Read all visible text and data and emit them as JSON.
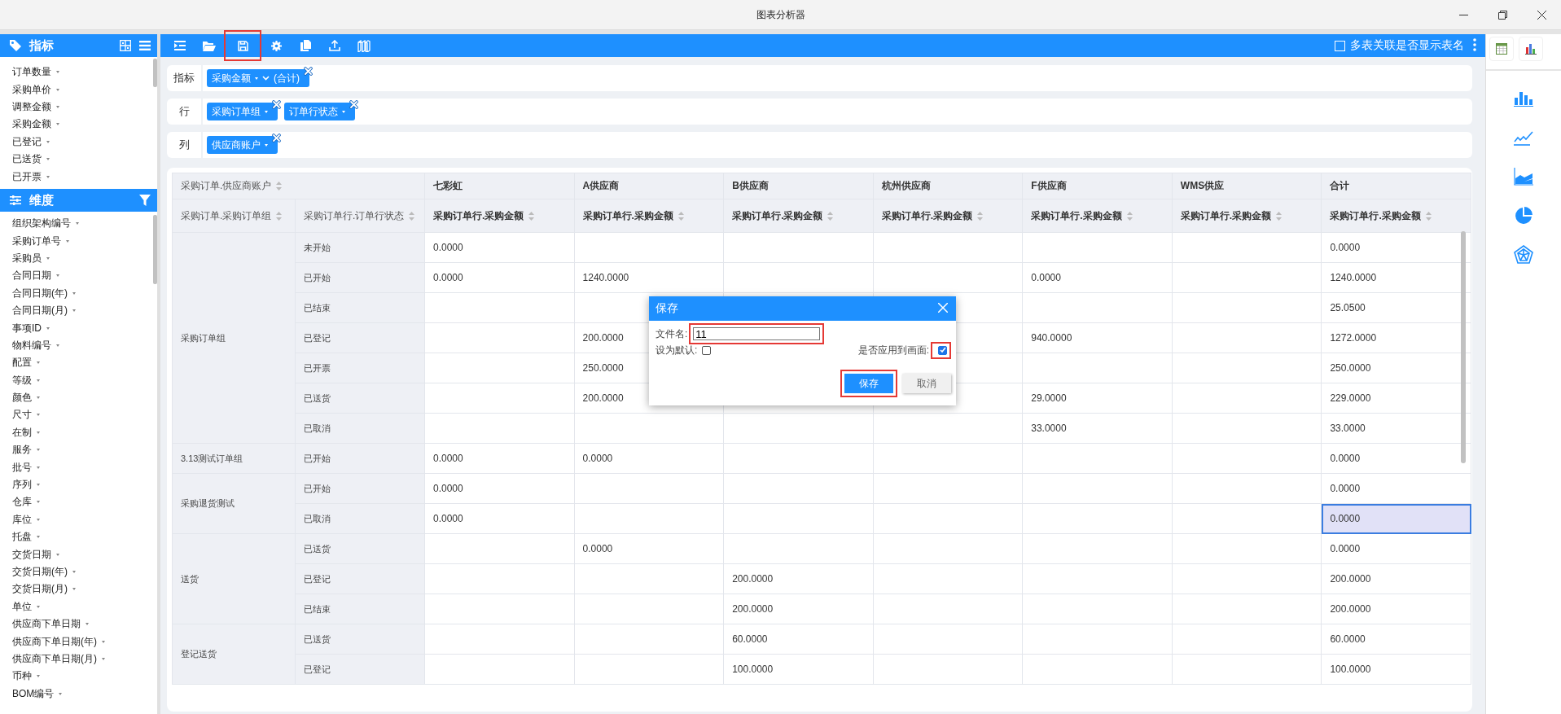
{
  "window": {
    "title": "图表分析器"
  },
  "sidebar": {
    "measures": {
      "title": "指标",
      "items": [
        "订单数量",
        "采购单价",
        "调整金额",
        "采购金额",
        "已登记",
        "已送货",
        "已开票"
      ]
    },
    "dimensions": {
      "title": "维度",
      "items": [
        "组织架构编号",
        "采购订单号",
        "采购员",
        "合同日期",
        "合同日期(年)",
        "合同日期(月)",
        "事项ID",
        "物料编号",
        "配置",
        "等级",
        "颜色",
        "尺寸",
        "在制",
        "服务",
        "批号",
        "序列",
        "仓库",
        "库位",
        "托盘",
        "交货日期",
        "交货日期(年)",
        "交货日期(月)",
        "单位",
        "供应商下单日期",
        "供应商下单日期(年)",
        "供应商下单日期(月)",
        "币种",
        "BOM编号"
      ]
    }
  },
  "toolbar": {
    "buttons": [
      {
        "kind": "indent",
        "highlighted": false
      },
      {
        "kind": "folder",
        "highlighted": false
      },
      {
        "kind": "save",
        "highlighted": true
      },
      {
        "kind": "settings",
        "highlighted": false
      },
      {
        "kind": "copy",
        "highlighted": false
      },
      {
        "kind": "upload",
        "highlighted": false
      },
      {
        "kind": "books",
        "highlighted": false
      }
    ],
    "show_table_names": {
      "label": "多表关联是否显示表名",
      "checked": false
    }
  },
  "shelves": [
    {
      "label": "指标",
      "chips": [
        {
          "text": "采购金额",
          "aggregate": "(合计)"
        }
      ]
    },
    {
      "label": "行",
      "chips": [
        {
          "text": "采购订单组"
        },
        {
          "text": "订单行状态"
        }
      ]
    },
    {
      "label": "列",
      "chips": [
        {
          "text": "供应商账户"
        }
      ]
    }
  ],
  "table": {
    "corner_label": "采购订单.供应商账户",
    "suppliers": [
      "七彩虹",
      "A供应商",
      "B供应商",
      "杭州供应商",
      "F供应商",
      "WMS供应",
      "合计"
    ],
    "row_headers": [
      "采购订单.采购订单组",
      "采购订单行.订单行状态"
    ],
    "measure_headers": [
      "采购订单行.采购金额",
      "采购订单行.采购金额",
      "采购订单行.采购金额",
      "采购订单行.采购金额",
      "采购订单行.采购金额",
      "采购订单行.采购金额",
      "采购订单行.采购金额"
    ],
    "groups": [
      {
        "name": "采购订单组",
        "rows": [
          {
            "status": "未开始",
            "selected": false,
            "cells": [
              "0.0000",
              null,
              null,
              null,
              null,
              null,
              "0.0000"
            ]
          },
          {
            "status": "已开始",
            "selected": false,
            "cells": [
              "0.0000",
              "1240.0000",
              null,
              null,
              "0.0000",
              null,
              "1240.0000"
            ]
          },
          {
            "status": "已结束",
            "selected": false,
            "cells": [
              null,
              null,
              null,
              null,
              null,
              null,
              "25.0500"
            ]
          },
          {
            "status": "已登记",
            "selected": false,
            "cells": [
              null,
              "200.0000",
              null,
              null,
              "940.0000",
              null,
              "1272.0000"
            ]
          },
          {
            "status": "已开票",
            "selected": false,
            "cells": [
              null,
              "250.0000",
              null,
              null,
              null,
              null,
              "250.0000"
            ]
          },
          {
            "status": "已送货",
            "selected": false,
            "cells": [
              null,
              "200.0000",
              null,
              null,
              "29.0000",
              null,
              "229.0000"
            ]
          },
          {
            "status": "已取消",
            "selected": false,
            "cells": [
              null,
              null,
              null,
              null,
              "33.0000",
              null,
              "33.0000"
            ]
          }
        ]
      },
      {
        "name": "3.13测试订单组",
        "rows": [
          {
            "status": "已开始",
            "selected": false,
            "cells": [
              "0.0000",
              "0.0000",
              null,
              null,
              null,
              null,
              "0.0000"
            ]
          }
        ]
      },
      {
        "name": "采购退货测试",
        "rows": [
          {
            "status": "已开始",
            "selected": false,
            "cells": [
              "0.0000",
              null,
              null,
              null,
              null,
              null,
              "0.0000"
            ]
          },
          {
            "status": "已取消",
            "selected": true,
            "cells": [
              "0.0000",
              null,
              null,
              null,
              null,
              null,
              "0.0000"
            ]
          }
        ]
      },
      {
        "name": "送货",
        "rows": [
          {
            "status": "已送货",
            "selected": false,
            "cells": [
              null,
              "0.0000",
              null,
              null,
              null,
              null,
              "0.0000"
            ]
          },
          {
            "status": "已登记",
            "selected": false,
            "cells": [
              null,
              null,
              "200.0000",
              null,
              null,
              null,
              "200.0000"
            ]
          },
          {
            "status": "已结束",
            "selected": false,
            "cells": [
              null,
              null,
              "200.0000",
              null,
              null,
              null,
              "200.0000"
            ]
          }
        ]
      },
      {
        "name": "登记送货",
        "rows": [
          {
            "status": "已送货",
            "selected": false,
            "cells": [
              null,
              null,
              "60.0000",
              null,
              null,
              null,
              "60.0000"
            ]
          },
          {
            "status": "已登记",
            "selected": false,
            "cells": [
              null,
              null,
              "100.0000",
              null,
              null,
              null,
              "100.0000"
            ]
          }
        ]
      }
    ]
  },
  "dialog": {
    "title": "保存",
    "filename": {
      "label": "文件名:",
      "value": "11",
      "highlighted": true
    },
    "set_default": {
      "label": "设为默认:",
      "checked": false,
      "highlighted": false
    },
    "apply": {
      "label": "是否应用到画面:",
      "checked": true,
      "highlighted": true
    },
    "buttons": [
      {
        "kind": "primary",
        "label": "保存",
        "highlighted": true
      },
      {
        "kind": "secondary",
        "label": "取消",
        "highlighted": false
      }
    ]
  },
  "chart_panel": {
    "tabs": [
      {
        "kind": "table"
      },
      {
        "kind": "chart"
      }
    ],
    "chart_types": [
      {
        "kind": "bar"
      },
      {
        "kind": "line"
      },
      {
        "kind": "area"
      },
      {
        "kind": "pie"
      },
      {
        "kind": "radar"
      }
    ]
  }
}
